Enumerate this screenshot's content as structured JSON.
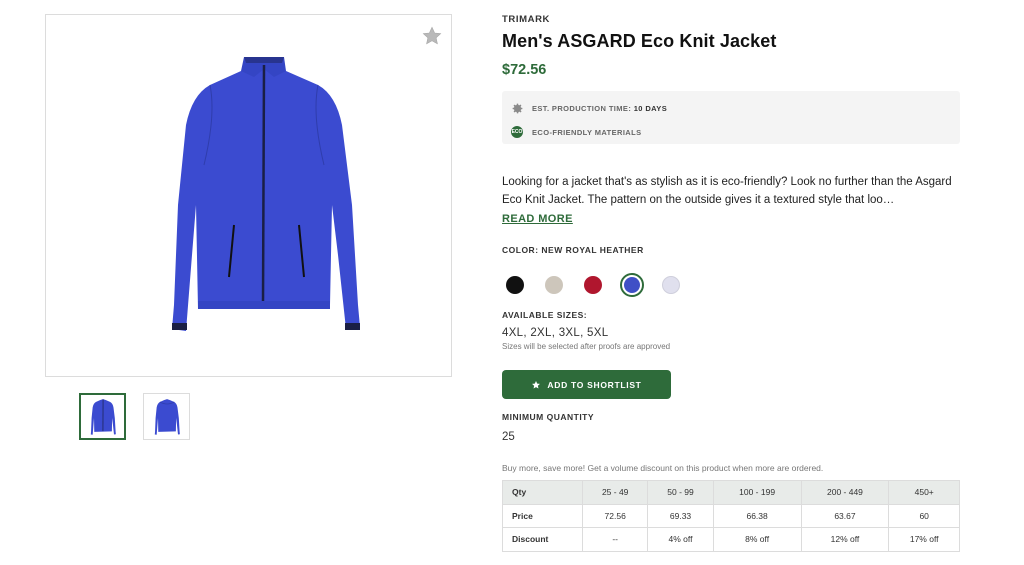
{
  "product": {
    "brand": "TRIMARK",
    "title": "Men's ASGARD Eco Knit Jacket",
    "price": "$72.56",
    "production_time_label": "EST. PRODUCTION TIME:",
    "production_time_value": "10 DAYS",
    "eco_label": "ECO-FRIENDLY MATERIALS",
    "eco_badge": "ECO",
    "description": "Looking for a jacket that's as stylish as it is eco-friendly? Look no further than the Asgard Eco Knit Jacket. The pattern on the outside gives it a textured style that loo…",
    "read_more": "READ MORE"
  },
  "color": {
    "label": "COLOR: NEW ROYAL HEATHER",
    "swatches": [
      "#111111",
      "#cdc6bb",
      "#b0162e",
      "#3f4fc6",
      "#e0e0ee"
    ],
    "selected_index": 3
  },
  "sizes": {
    "label": "AVAILABLE SIZES:",
    "value": "4XL, 2XL, 3XL, 5XL",
    "note": "Sizes will be selected after proofs are approved"
  },
  "actions": {
    "shortlist_label": "ADD TO SHORTLIST"
  },
  "min_quantity": {
    "label": "MINIMUM QUANTITY",
    "value": "25"
  },
  "volume": {
    "note": "Buy more, save more! Get a volume discount on this product when more are ordered.",
    "headers": [
      "Qty",
      "25 - 49",
      "50 - 99",
      "100 - 199",
      "200 - 449",
      "450+"
    ],
    "price_row": [
      "Price",
      "72.56",
      "69.33",
      "66.38",
      "63.67",
      "60"
    ],
    "discount_row": [
      "Discount",
      "--",
      "4% off",
      "8% off",
      "12% off",
      "17% off"
    ]
  },
  "colors": {
    "accent": "#2e6b3a",
    "jacket": "#3b4bd0"
  },
  "icons": {
    "favorite": "star-icon",
    "production": "gear-icon",
    "eco": "eco-leaf-icon",
    "shortlist": "star-icon"
  }
}
